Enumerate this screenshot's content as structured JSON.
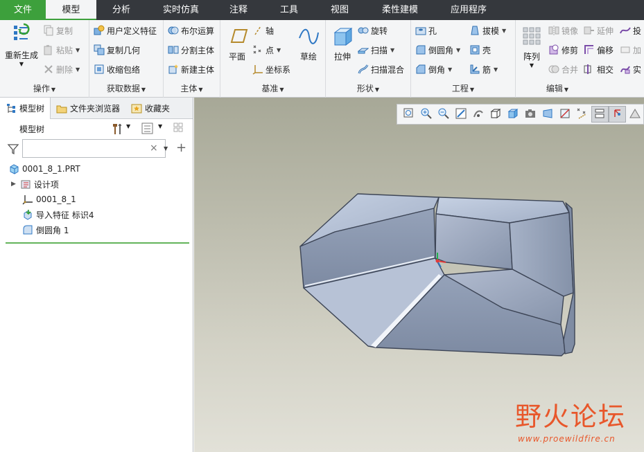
{
  "menubar": {
    "tabs": [
      {
        "label": "文件",
        "width": 66
      },
      {
        "label": "模型",
        "width": 73
      },
      {
        "label": "分析",
        "width": 72
      },
      {
        "label": "实时仿真",
        "width": 100
      },
      {
        "label": "注释",
        "width": 66
      },
      {
        "label": "工具",
        "width": 80
      },
      {
        "label": "视图",
        "width": 66
      },
      {
        "label": "柔性建模",
        "width": 108
      },
      {
        "label": "应用程序",
        "width": 90
      }
    ]
  },
  "ribbon": {
    "operations": {
      "label": "操作",
      "regenerate": "重新生成",
      "copy": "复制",
      "paste": "粘贴",
      "delete": "删除"
    },
    "get_data": {
      "label": "获取数据",
      "udf": "用户定义特征",
      "copy_geom": "复制几何",
      "shrinkwrap": "收缩包络"
    },
    "body": {
      "label": "主体",
      "boolean": "布尔运算",
      "split": "分割主体",
      "new_body": "新建主体"
    },
    "datum": {
      "label": "基准",
      "plane": "平面",
      "axis": "轴",
      "point": "点",
      "csys": "坐标系",
      "sketch": "草绘"
    },
    "shapes": {
      "label": "形状",
      "extrude": "拉伸",
      "revolve": "旋转",
      "sweep": "扫描",
      "swept_blend": "扫描混合"
    },
    "engineering": {
      "label": "工程",
      "hole": "孔",
      "round": "倒圆角",
      "chamfer": "倒角",
      "draft": "拔模",
      "shell": "壳",
      "rib": "筋"
    },
    "editing": {
      "label": "编辑",
      "pattern": "阵列",
      "mirror": "镜像",
      "trim": "修剪",
      "merge": "合并",
      "extend": "延伸",
      "offset": "偏移",
      "intersect": "相交",
      "project": "投",
      "thicken": "加",
      "solidify": "实"
    }
  },
  "left_panel": {
    "tabs": [
      "模型树",
      "文件夹浏览器",
      "收藏夹"
    ],
    "tree_header": "模型树",
    "search_placeholder": "",
    "tree_items": [
      {
        "label": "0001_8_1.PRT",
        "icon": "part-icon"
      },
      {
        "label": "设计项",
        "icon": "design-items-icon"
      },
      {
        "label": "0001_8_1",
        "icon": "csys-icon"
      },
      {
        "label": "导入特征 标识4",
        "icon": "import-feature-icon"
      },
      {
        "label": "倒圆角 1",
        "icon": "round-icon"
      }
    ]
  },
  "watermark": {
    "text": "野火论坛",
    "url": "www.proewildfire.cn"
  },
  "colors": {
    "menubar_bg": "#35383d",
    "file_tab": "#3da03c",
    "accent_green": "#63b35a",
    "model_face": "#8f9cb3",
    "watermark": "#e8572b"
  }
}
